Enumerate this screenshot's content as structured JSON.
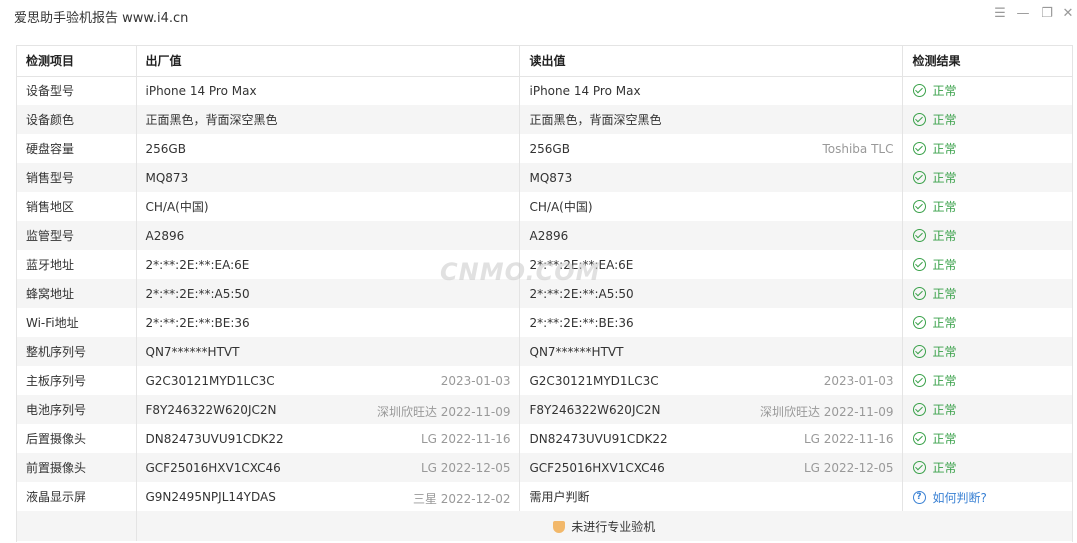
{
  "window": {
    "title": "爱思助手验机报告 www.i4.cn",
    "controls": [
      "menu-icon",
      "minimize-icon",
      "restore-icon",
      "close-icon"
    ]
  },
  "table": {
    "headers": [
      "检测项目",
      "出厂值",
      "读出值",
      "检测结果"
    ],
    "rows": [
      {
        "item": "设备型号",
        "factory": "iPhone 14 Pro Max",
        "factory_meta": "",
        "read": "iPhone 14 Pro Max",
        "read_meta": "",
        "result": "正常"
      },
      {
        "item": "设备颜色",
        "factory": "正面黑色，背面深空黑色",
        "factory_meta": "",
        "read": "正面黑色，背面深空黑色",
        "read_meta": "",
        "result": "正常"
      },
      {
        "item": "硬盘容量",
        "factory": "256GB",
        "factory_meta": "",
        "read": "256GB",
        "read_meta": "Toshiba TLC",
        "result": "正常"
      },
      {
        "item": "销售型号",
        "factory": "MQ873",
        "factory_meta": "",
        "read": "MQ873",
        "read_meta": "",
        "result": "正常"
      },
      {
        "item": "销售地区",
        "factory": "CH/A(中国)",
        "factory_meta": "",
        "read": "CH/A(中国)",
        "read_meta": "",
        "result": "正常"
      },
      {
        "item": "监管型号",
        "factory": "A2896",
        "factory_meta": "",
        "read": "A2896",
        "read_meta": "",
        "result": "正常"
      },
      {
        "item": "蓝牙地址",
        "factory": "2*:**:2E:**:EA:6E",
        "factory_meta": "",
        "read": "2*:**:2E:**:EA:6E",
        "read_meta": "",
        "result": "正常"
      },
      {
        "item": "蜂窝地址",
        "factory": "2*:**:2E:**:A5:50",
        "factory_meta": "",
        "read": "2*:**:2E:**:A5:50",
        "read_meta": "",
        "result": "正常"
      },
      {
        "item": "Wi-Fi地址",
        "factory": "2*:**:2E:**:BE:36",
        "factory_meta": "",
        "read": "2*:**:2E:**:BE:36",
        "read_meta": "",
        "result": "正常"
      },
      {
        "item": "整机序列号",
        "factory": "QN7******HTVT",
        "factory_meta": "",
        "read": "QN7******HTVT",
        "read_meta": "",
        "result": "正常"
      },
      {
        "item": "主板序列号",
        "factory": "G2C30121MYD1LC3C",
        "factory_meta": "2023-01-03",
        "read": "G2C30121MYD1LC3C",
        "read_meta": "2023-01-03",
        "result": "正常"
      },
      {
        "item": "电池序列号",
        "factory": "F8Y246322W620JC2N",
        "factory_meta": "深圳欣旺达 2022-11-09",
        "read": "F8Y246322W620JC2N",
        "read_meta": "深圳欣旺达 2022-11-09",
        "result": "正常"
      },
      {
        "item": "后置摄像头",
        "factory": "DN82473UVU91CDK22",
        "factory_meta": "LG 2022-11-16",
        "read": "DN82473UVU91CDK22",
        "read_meta": "LG 2022-11-16",
        "result": "正常"
      },
      {
        "item": "前置摄像头",
        "factory": "GCF25016HXV1CXC46",
        "factory_meta": "LG 2022-12-05",
        "read": "GCF25016HXV1CXC46",
        "read_meta": "LG 2022-12-05",
        "result": "正常"
      },
      {
        "item": "液晶显示屏",
        "factory": "G9N2495NPJL14YDAS",
        "factory_meta": "三星 2022-12-02",
        "read": "需用户判断",
        "read_meta": "",
        "result": "如何判断?"
      }
    ],
    "footer_text": "未进行专业验机"
  },
  "watermark": "CNMO.COM",
  "colors": {
    "ok": "#3aa14a",
    "link": "#3b82d4",
    "zebra": "#f5f5f5",
    "border": "#e4e4e4"
  }
}
